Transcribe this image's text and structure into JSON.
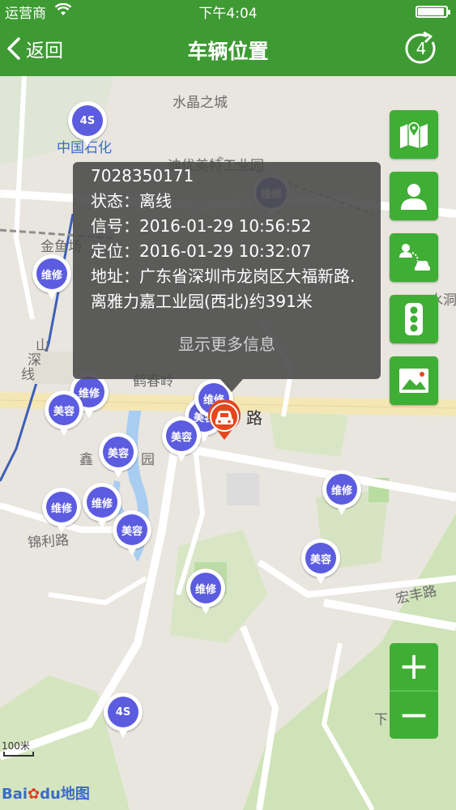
{
  "status_bar": {
    "carrier": "运营商",
    "time": "下午4:04"
  },
  "nav": {
    "back_label": "返回",
    "title": "车辆位置",
    "refresh_count": "4"
  },
  "map_labels": {
    "crystal_city": "水晶之城",
    "sinopec": "中国石化",
    "factory": "迪优美特工业园",
    "jinyu": "金鱼场",
    "shan": "山",
    "shen": "深",
    "xian": "线",
    "hechunling": "鹤春岭",
    "road_suffix": "路",
    "xin": "鑫",
    "yuan": "园",
    "jinli_road": "锦利路",
    "hongfeng_road": "宏丰路",
    "shui_dong": "水洞",
    "xia": "下"
  },
  "popup": {
    "plate": "7028350171",
    "status_label": "状态：",
    "status_value": "离线",
    "signal_label": "信号：",
    "signal_value": "2016-01-29 10:56:52",
    "position_label": "定位：",
    "position_value": "2016-01-29 10:32:07",
    "address_label": "地址：",
    "address_value": "广东省深圳市龙岗区大福新路.离雅力嘉工业园(西北)约391米",
    "more_label": "显示更多信息"
  },
  "pins": [
    {
      "text": "4S"
    },
    {
      "text": "维修"
    },
    {
      "text": "维修"
    },
    {
      "text": "维修"
    },
    {
      "text": "美容"
    },
    {
      "text": "美容"
    },
    {
      "text": "美容"
    },
    {
      "text": "美容"
    },
    {
      "text": "维修"
    },
    {
      "text": "维修"
    },
    {
      "text": "维修"
    },
    {
      "text": "美容"
    },
    {
      "text": "维修"
    },
    {
      "text": "美容"
    },
    {
      "text": "维修"
    },
    {
      "text": "4S"
    }
  ],
  "map_controls": {
    "side_buttons": [
      "map-pin-icon",
      "person-icon",
      "person-car-icon",
      "traffic-light-icon",
      "landscape-icon"
    ],
    "zoom_in": "+",
    "zoom_out": "−"
  },
  "scale": "100米",
  "logo": {
    "bai": "Bai",
    "du": "du",
    "map": "地图"
  },
  "colors": {
    "header": "#3e9a33",
    "button": "#3fae35",
    "pin": "#5c5ce0",
    "car": "#e4461e"
  }
}
